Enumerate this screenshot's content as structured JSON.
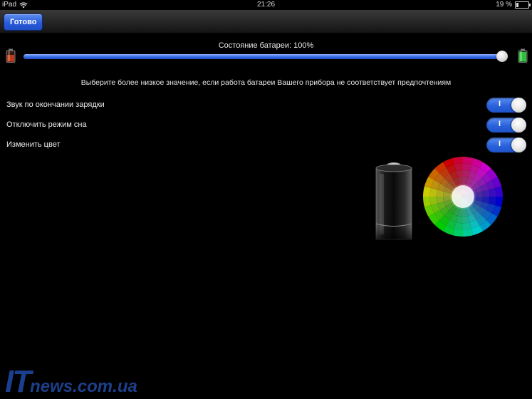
{
  "status_bar": {
    "device": "iPad",
    "time": "21:26",
    "battery_percent": "19 %",
    "battery_level": 0.19
  },
  "navbar": {
    "done_label": "Готово"
  },
  "battery": {
    "title": "Состояние батареи: 100%",
    "slider_value": 1.0
  },
  "hint": "Выберите более низкое значение, если работа батареи Вашего прибора не соответствует предпочтениям",
  "settings": [
    {
      "label": "Звук по окончании зарядки",
      "switch_text": "I",
      "on": true
    },
    {
      "label": "Отключить режим сна",
      "switch_text": "I",
      "on": true
    },
    {
      "label": "Изменить цвет",
      "switch_text": "I",
      "on": true
    }
  ],
  "watermark": {
    "big": "IT",
    "rest": "news.com.ua"
  },
  "colors": {
    "accent": "#2a62dc",
    "background": "#000000",
    "watermark": "#1b3f8f"
  }
}
